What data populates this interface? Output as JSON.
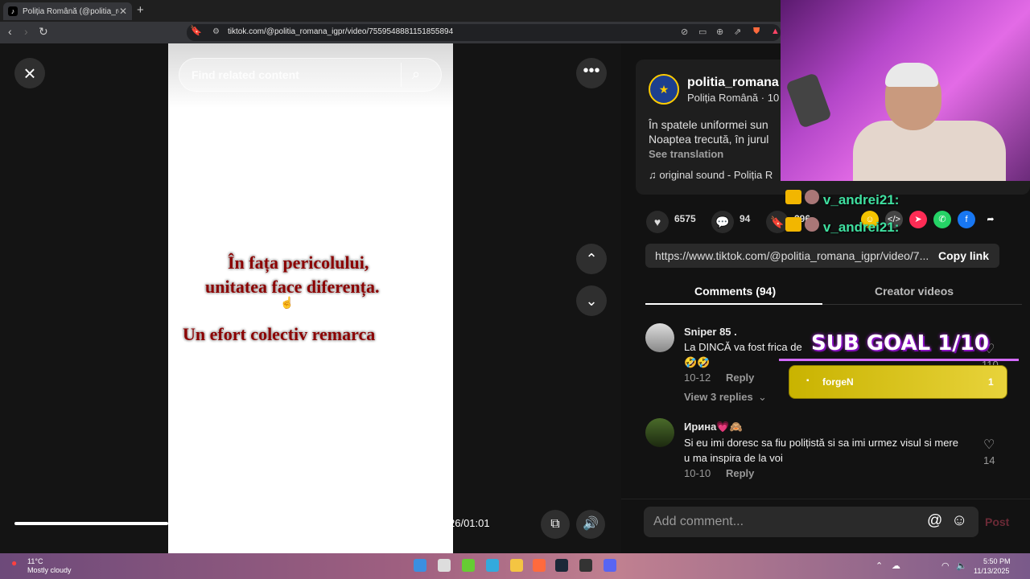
{
  "browser": {
    "tab_title": "Poliția Română (@politia_rom",
    "tab_close": "✕",
    "new_tab": "+",
    "url": "tiktok.com/@politia_romana_igpr/video/7559548881151855894"
  },
  "video": {
    "search_placeholder": "Find related content",
    "caption_line1": "În fața pericolului,",
    "caption_line2": "unitatea face diferența.",
    "caption_line3": "Un efort colectiv remarca",
    "time": "26/01:01",
    "progress": 0.25
  },
  "post": {
    "username": "politia_romana",
    "nickname": "Poliția Română · 10",
    "desc_line1": "În spatele uniformei sun",
    "desc_line2": "Noaptea trecută, în jurul",
    "see_translation": "See translation",
    "sound": "original sound - Poliția R",
    "likes": "6575",
    "comments": "94",
    "saves": "296",
    "link": "https://www.tiktok.com/@politia_romana_igpr/video/7...",
    "copy_link": "Copy link"
  },
  "tabs": {
    "comments": "Comments (94)",
    "creator": "Creator videos"
  },
  "comments": [
    {
      "name": "Sniper 85 .",
      "text1": "La DINCĂ va fost frica de",
      "text2": "🤣🤣",
      "date": "10-12",
      "reply": "Reply",
      "view_replies": "View 3 replies",
      "likes": "110"
    },
    {
      "name": "Ирина💗🙈",
      "text1": "Si eu imi doresc sa fiu polițistă si sa imi urmez visul si mere",
      "text2": "u ma inspira de la voi",
      "date": "10-10",
      "reply": "Reply",
      "likes": "14"
    }
  ],
  "comment_box": {
    "placeholder": "Add comment...",
    "post": "Post"
  },
  "overlay": {
    "chat1": "v_andrei21:",
    "chat2": "v_andrei21:",
    "sub_goal": "SUB GOAL 1/10",
    "goal_user": "forgeN",
    "goal_count": "1"
  },
  "taskbar": {
    "temp": "11°C",
    "weather": "Mostly cloudy",
    "time": "5:50 PM",
    "date": "11/13/2025"
  },
  "colors": {
    "accent": "#fe2c55",
    "goal": "#e8d33b",
    "chat": "#3fe0a0"
  }
}
